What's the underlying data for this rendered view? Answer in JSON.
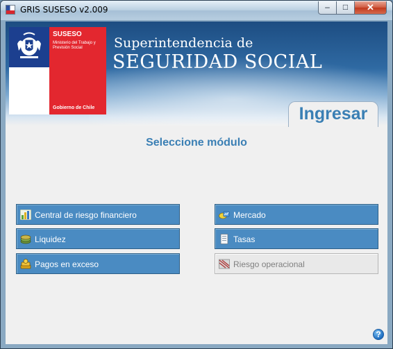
{
  "window": {
    "title": "GRIS SUSESO v2.009",
    "controls": {
      "minimize": "–",
      "maximize": "□",
      "close": "✕"
    }
  },
  "banner": {
    "logo": {
      "org": "SUSESO",
      "ministry": "Ministerio del Trabajo y Previsión Social",
      "government": "Gobierno de Chile"
    },
    "subtitle": "Superintendencia de",
    "title": "SEGURIDAD SOCIAL",
    "tab_label": "Ingresar"
  },
  "main": {
    "heading": "Seleccione módulo",
    "modules": [
      {
        "label": "Central de riesgo financiero",
        "icon": "bar-chart-icon",
        "enabled": true
      },
      {
        "label": "Liquidez",
        "icon": "coins-icon",
        "enabled": true
      },
      {
        "label": "Pagos en exceso",
        "icon": "money-stack-icon",
        "enabled": true
      },
      {
        "label": "Mercado",
        "icon": "market-icon",
        "enabled": true
      },
      {
        "label": "Tasas",
        "icon": "document-icon",
        "enabled": true
      },
      {
        "label": "Riesgo operacional",
        "icon": "risk-icon",
        "enabled": false
      }
    ],
    "help": "?"
  },
  "colors": {
    "accent_text": "#3a7fb4",
    "button_blue": "#4a8bc2",
    "flag_blue": "#1c3f8f",
    "flag_red": "#e3272f"
  }
}
